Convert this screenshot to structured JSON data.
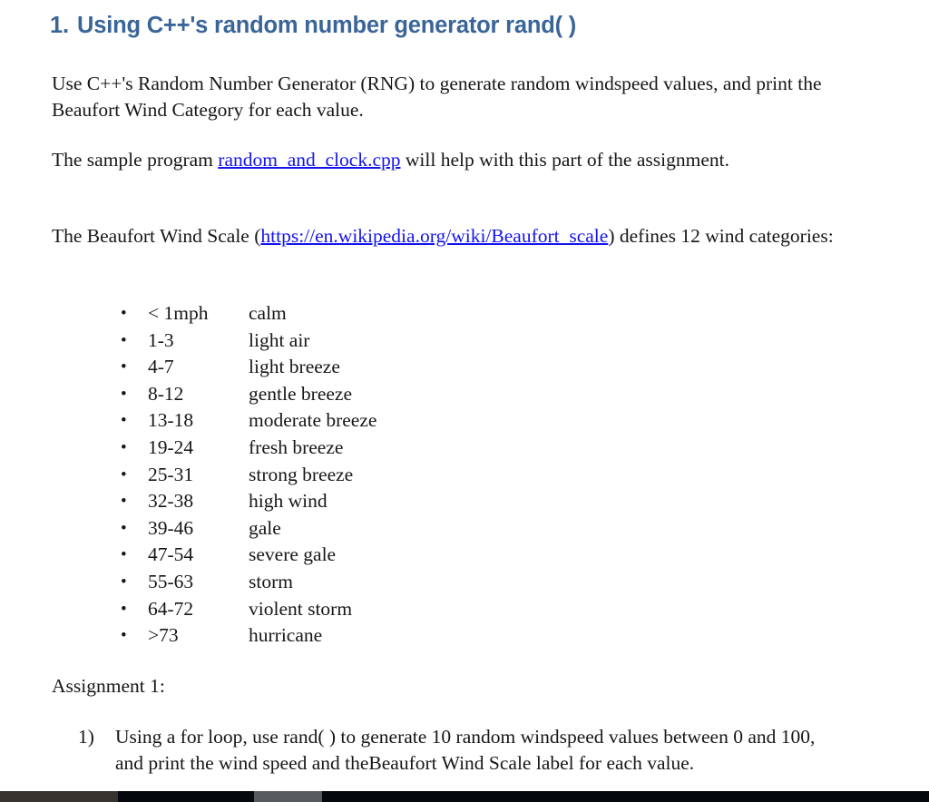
{
  "document": {
    "heading_number": "1.",
    "heading_text": "Using C++'s random number generator rand( )",
    "heading_color": "#3A6599",
    "link_color": "#1414EE",
    "background_color": "#FFFFFF",
    "body_color": "#17171A"
  },
  "paragraphs": {
    "intro": "Use C++'s Random Number Generator (RNG) to generate random windspeed values, and print the Beaufort Wind Category for each value.",
    "sample_before": "The sample program ",
    "sample_link": "random_and_clock.cpp",
    "sample_after": " will help with this part of the assignment.",
    "scale_before": "The Beaufort Wind Scale (",
    "scale_link": "https://en.wikipedia.org/wiki/Beaufort_scale",
    "scale_after": ") defines 12 wind categories:",
    "assignment_heading": "Assignment 1:"
  },
  "categories": {
    "bullet_glyph": "•",
    "rows": [
      {
        "range": "< 1mph",
        "label": "calm"
      },
      {
        "range": "1-3",
        "label": "light air"
      },
      {
        "range": "4-7",
        "label": "light breeze"
      },
      {
        "range": "8-12",
        "label": "gentle breeze"
      },
      {
        "range": "13-18",
        "label": "moderate breeze"
      },
      {
        "range": "19-24",
        "label": "fresh breeze"
      },
      {
        "range": "25-31",
        "label": "strong breeze"
      },
      {
        "range": "32-38",
        "label": "high wind"
      },
      {
        "range": "39-46",
        "label": "gale"
      },
      {
        "range": "47-54",
        "label": "severe gale"
      },
      {
        "range": "55-63",
        "label": "storm"
      },
      {
        "range": "64-72",
        "label": "violent storm"
      },
      {
        "range": ">73",
        "label": "hurricane"
      }
    ]
  },
  "assignment_items": [
    {
      "marker": "1)",
      "text": "Using a for loop, use rand( ) to generate 10 random windspeed values between 0 and 100, and print the wind speed and theBeaufort Wind Scale label for each value."
    }
  ],
  "taskbar": {
    "segment_colors": [
      "#36332F",
      "#05090D",
      "#565B5F",
      "#05090D"
    ]
  }
}
